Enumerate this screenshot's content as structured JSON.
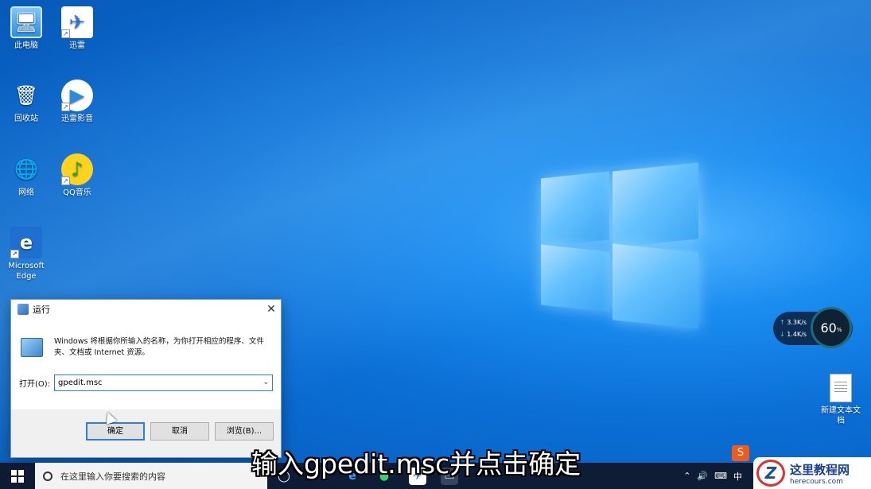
{
  "desktop": {
    "icons": [
      {
        "label": "此电脑",
        "icon": "computer-icon"
      },
      {
        "label": "迅雷",
        "icon": "xunlei-icon"
      },
      {
        "label": "回收站",
        "icon": "recycle-bin-icon"
      },
      {
        "label": "迅雷影音",
        "icon": "xunlei-player-icon"
      },
      {
        "label": "网络",
        "icon": "network-icon"
      },
      {
        "label": "QQ音乐",
        "icon": "qq-music-icon"
      },
      {
        "label": "Microsoft Edge",
        "icon": "edge-icon"
      }
    ],
    "text_file": {
      "label": "新建文本文档"
    }
  },
  "run_dialog": {
    "title": "运行",
    "description": "Windows 将根据你所输入的名称，为你打开相应的程序、文件夹、文档或 Internet 资源。",
    "open_label": "打开(O):",
    "open_value": "gpedit.msc",
    "ok_label": "确定",
    "cancel_label": "取消",
    "browse_label": "浏览(B)..."
  },
  "subtitle": "输入gpedit.msc并点击确定",
  "taskbar": {
    "search_placeholder": "在这里输入你要搜索的内容",
    "tray_ime": "中"
  },
  "speed_widget": {
    "upload": "3.3",
    "download": "1.4",
    "unit": "K/s",
    "percent": "60",
    "percent_unit": "%"
  },
  "watermark": {
    "title": "这里教程网",
    "url": "herecours.com"
  },
  "colors": {
    "accent": "#2b7fd8",
    "taskbar": "#101628",
    "upload": "#4fc3ff",
    "download": "#3fe07a"
  }
}
